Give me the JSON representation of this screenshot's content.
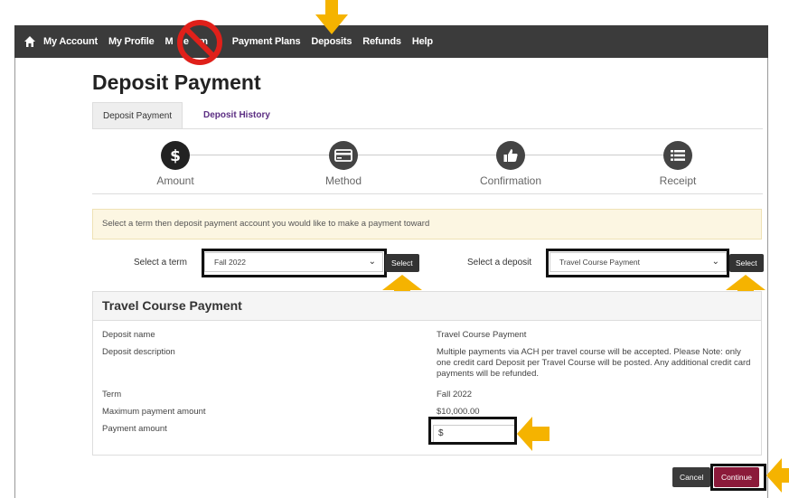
{
  "nav": {
    "items": [
      "My Account",
      "My Profile",
      "Make Payment",
      "Payment Plans",
      "Deposits",
      "Refunds",
      "Help"
    ],
    "make_payment_visible": "M    e    m    t"
  },
  "page": {
    "title": "Deposit Payment"
  },
  "tabs": [
    {
      "label": "Deposit Payment"
    },
    {
      "label": "Deposit History"
    }
  ],
  "steps": [
    {
      "label": "Amount",
      "icon": "dollar-icon"
    },
    {
      "label": "Method",
      "icon": "card-icon"
    },
    {
      "label": "Confirmation",
      "icon": "thumbs-up-icon"
    },
    {
      "label": "Receipt",
      "icon": "list-icon"
    }
  ],
  "notice": "Select a term then deposit payment account you would like to make a payment toward",
  "term": {
    "label": "Select a term",
    "value": "Fall 2022",
    "button": "Select"
  },
  "deposit": {
    "label": "Select a deposit",
    "value": "Travel Course Payment",
    "button": "Select"
  },
  "panel": {
    "title": "Travel Course Payment",
    "rows": [
      {
        "label": "Deposit name",
        "value": "Travel Course Payment"
      },
      {
        "label": "Deposit description",
        "value": "Multiple payments via ACH per travel course will be accepted. Please Note: only one credit card Deposit per Travel Course will be posted. Any additional credit card payments will be refunded."
      },
      {
        "label": "Term",
        "value": "Fall 2022"
      },
      {
        "label": "Maximum payment amount",
        "value": "$10,000.00"
      },
      {
        "label": "Payment amount",
        "value": "$"
      }
    ]
  },
  "buttons": {
    "cancel": "Cancel",
    "continue": "Continue"
  },
  "colors": {
    "navbar": "#3b3b3b",
    "accent": "#8b1a3a",
    "tab_link": "#5b2d82",
    "arrow": "#f5b300",
    "no_sign": "#e0201a"
  }
}
